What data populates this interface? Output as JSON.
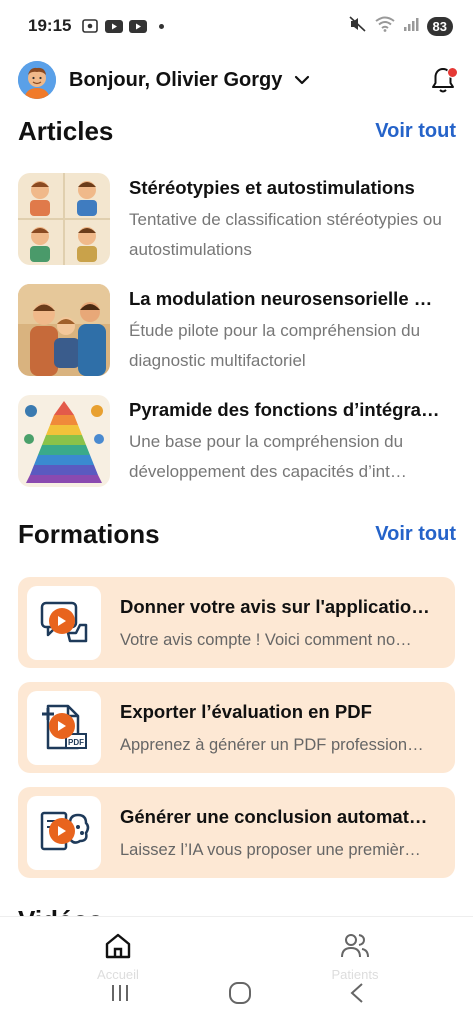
{
  "status_bar": {
    "time": "19:15",
    "battery": "83"
  },
  "header": {
    "greeting": "Bonjour, Olivier Gorgy"
  },
  "articles": {
    "title": "Articles",
    "see_all": "Voir tout",
    "items": [
      {
        "title": "Stéréotypies et autostimulations",
        "description": "Tentative de classification stéréotypies ou autostimulations"
      },
      {
        "title": "La modulation neurosensorielle …",
        "description": "Étude pilote pour la compréhension du diagnostic multifactoriel"
      },
      {
        "title": "Pyramide des fonctions d’intégra…",
        "description": "Une base pour la compréhension du développement des capacités d’int…"
      }
    ]
  },
  "formations": {
    "title": "Formations",
    "see_all": "Voir tout",
    "items": [
      {
        "title": "Donner votre avis sur l'applicatio…",
        "description": "Votre avis compte ! Voici comment no…"
      },
      {
        "title": "Exporter l’évaluation en PDF",
        "description": "Apprenez à générer un PDF profession…"
      },
      {
        "title": "Générer une conclusion automat…",
        "description": "Laissez l’IA vous proposer une premièr…"
      }
    ]
  },
  "next_section": {
    "title": "Vidéos"
  },
  "bottom_nav": {
    "home_label": "Accueil",
    "patients_label": "Patients"
  },
  "colors": {
    "accent": "#2563c9",
    "card_bg": "#fde8d4",
    "play": "#e8641e",
    "badge": "#e53935"
  }
}
